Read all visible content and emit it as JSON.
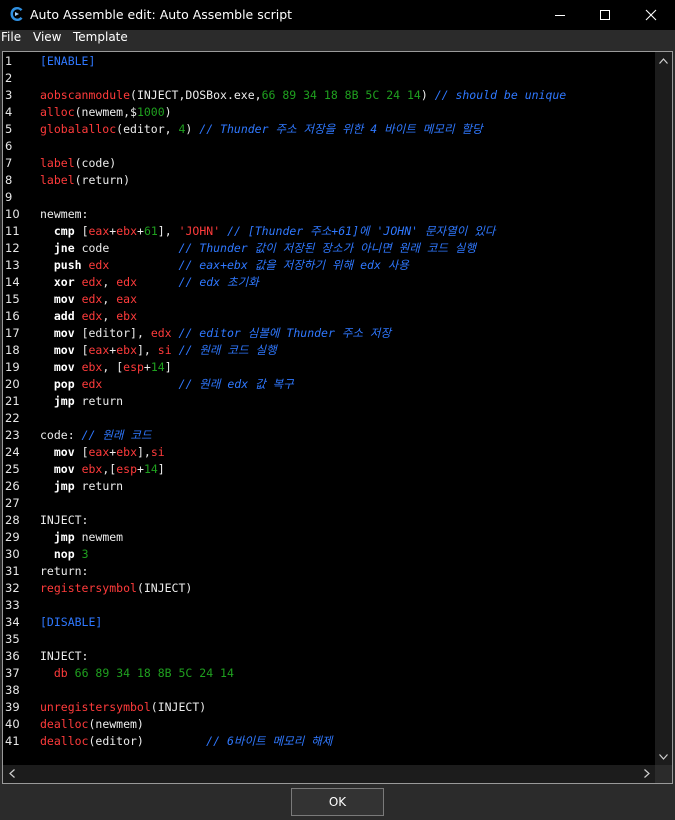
{
  "window": {
    "title": "Auto Assemble edit: Auto Assemble script",
    "controls": [
      "minimize-icon",
      "maximize-icon",
      "close-icon"
    ],
    "app_icon": "cheat-engine-icon"
  },
  "menu": [
    {
      "label": "File"
    },
    {
      "label": "View"
    },
    {
      "label": "Template"
    }
  ],
  "editor": {
    "lines": [
      {
        "n": "1",
        "tokens": [
          [
            "sec",
            "[ENABLE]"
          ]
        ]
      },
      {
        "n": "2",
        "tokens": []
      },
      {
        "n": "3",
        "tokens": [
          [
            "kw",
            "aobscanmodule"
          ],
          [
            "plain",
            "(INJECT,DOSBox.exe,"
          ],
          [
            "num",
            "66 89 34 18 8B 5C 24 14"
          ],
          [
            "plain",
            ") "
          ],
          [
            "cmt",
            "// should be unique"
          ]
        ]
      },
      {
        "n": "4",
        "tokens": [
          [
            "kw",
            "alloc"
          ],
          [
            "plain",
            "(newmem,"
          ],
          [
            "plain",
            "$"
          ],
          [
            "num",
            "1000"
          ],
          [
            "plain",
            ")"
          ]
        ]
      },
      {
        "n": "5",
        "tokens": [
          [
            "kw",
            "globalalloc"
          ],
          [
            "plain",
            "(editor, "
          ],
          [
            "num",
            "4"
          ],
          [
            "plain",
            ") "
          ],
          [
            "cmt",
            "// Thunder 주소 저장을 위한 4 바이트 메모리 할당"
          ]
        ]
      },
      {
        "n": "6",
        "tokens": []
      },
      {
        "n": "7",
        "tokens": [
          [
            "kw",
            "label"
          ],
          [
            "plain",
            "(code)"
          ]
        ]
      },
      {
        "n": "8",
        "tokens": [
          [
            "kw",
            "label"
          ],
          [
            "plain",
            "(return)"
          ]
        ]
      },
      {
        "n": "9",
        "tokens": []
      },
      {
        "n": "10",
        "tokens": [
          [
            "plain",
            "newmem:"
          ]
        ]
      },
      {
        "n": "11",
        "tokens": [
          [
            "plain",
            "  "
          ],
          [
            "ins",
            "cmp"
          ],
          [
            "plain",
            " ["
          ],
          [
            "reg",
            "eax"
          ],
          [
            "plain",
            "+"
          ],
          [
            "reg",
            "ebx"
          ],
          [
            "plain",
            "+"
          ],
          [
            "num",
            "61"
          ],
          [
            "plain",
            "], "
          ],
          [
            "str",
            "'JOHN'"
          ],
          [
            "plain",
            " "
          ],
          [
            "cmt",
            "// [Thunder 주소+61]에 'JOHN' 문자열이 있다"
          ]
        ]
      },
      {
        "n": "12",
        "tokens": [
          [
            "plain",
            "  "
          ],
          [
            "ins",
            "jne"
          ],
          [
            "plain",
            " code          "
          ],
          [
            "cmt",
            "// Thunder 값이 저장된 장소가 아니면 원래 코드 실행"
          ]
        ]
      },
      {
        "n": "13",
        "tokens": [
          [
            "plain",
            "  "
          ],
          [
            "ins",
            "push"
          ],
          [
            "plain",
            " "
          ],
          [
            "reg",
            "edx"
          ],
          [
            "plain",
            "          "
          ],
          [
            "cmt",
            "// eax+ebx 값을 저장하기 위해 edx 사용"
          ]
        ]
      },
      {
        "n": "14",
        "tokens": [
          [
            "plain",
            "  "
          ],
          [
            "ins",
            "xor"
          ],
          [
            "plain",
            " "
          ],
          [
            "reg",
            "edx"
          ],
          [
            "plain",
            ", "
          ],
          [
            "reg",
            "edx"
          ],
          [
            "plain",
            "      "
          ],
          [
            "cmt",
            "// edx 초기화"
          ]
        ]
      },
      {
        "n": "15",
        "tokens": [
          [
            "plain",
            "  "
          ],
          [
            "ins",
            "mov"
          ],
          [
            "plain",
            " "
          ],
          [
            "reg",
            "edx"
          ],
          [
            "plain",
            ", "
          ],
          [
            "reg",
            "eax"
          ]
        ]
      },
      {
        "n": "16",
        "tokens": [
          [
            "plain",
            "  "
          ],
          [
            "ins",
            "add"
          ],
          [
            "plain",
            " "
          ],
          [
            "reg",
            "edx"
          ],
          [
            "plain",
            ", "
          ],
          [
            "reg",
            "ebx"
          ]
        ]
      },
      {
        "n": "17",
        "tokens": [
          [
            "plain",
            "  "
          ],
          [
            "ins",
            "mov"
          ],
          [
            "plain",
            " [editor], "
          ],
          [
            "reg",
            "edx"
          ],
          [
            "plain",
            " "
          ],
          [
            "cmt",
            "// editor 심볼에 Thunder 주소 저장"
          ]
        ]
      },
      {
        "n": "18",
        "tokens": [
          [
            "plain",
            "  "
          ],
          [
            "ins",
            "mov"
          ],
          [
            "plain",
            " ["
          ],
          [
            "reg",
            "eax"
          ],
          [
            "plain",
            "+"
          ],
          [
            "reg",
            "ebx"
          ],
          [
            "plain",
            "], "
          ],
          [
            "reg",
            "si"
          ],
          [
            "plain",
            " "
          ],
          [
            "cmt",
            "// 원래 코드 실행"
          ]
        ]
      },
      {
        "n": "19",
        "tokens": [
          [
            "plain",
            "  "
          ],
          [
            "ins",
            "mov"
          ],
          [
            "plain",
            " "
          ],
          [
            "reg",
            "ebx"
          ],
          [
            "plain",
            ", ["
          ],
          [
            "reg",
            "esp"
          ],
          [
            "plain",
            "+"
          ],
          [
            "num",
            "14"
          ],
          [
            "plain",
            "]"
          ]
        ]
      },
      {
        "n": "20",
        "tokens": [
          [
            "plain",
            "  "
          ],
          [
            "ins",
            "pop"
          ],
          [
            "plain",
            " "
          ],
          [
            "reg",
            "edx"
          ],
          [
            "plain",
            "           "
          ],
          [
            "cmt",
            "// 원래 edx 값 복구"
          ]
        ]
      },
      {
        "n": "21",
        "tokens": [
          [
            "plain",
            "  "
          ],
          [
            "ins",
            "jmp"
          ],
          [
            "plain",
            " return"
          ]
        ]
      },
      {
        "n": "22",
        "tokens": []
      },
      {
        "n": "23",
        "tokens": [
          [
            "plain",
            "code: "
          ],
          [
            "cmt",
            "// 원래 코드"
          ]
        ]
      },
      {
        "n": "24",
        "tokens": [
          [
            "plain",
            "  "
          ],
          [
            "ins",
            "mov"
          ],
          [
            "plain",
            " ["
          ],
          [
            "reg",
            "eax"
          ],
          [
            "plain",
            "+"
          ],
          [
            "reg",
            "ebx"
          ],
          [
            "plain",
            "],"
          ],
          [
            "reg",
            "si"
          ]
        ]
      },
      {
        "n": "25",
        "tokens": [
          [
            "plain",
            "  "
          ],
          [
            "ins",
            "mov"
          ],
          [
            "plain",
            " "
          ],
          [
            "reg",
            "ebx"
          ],
          [
            "plain",
            ",["
          ],
          [
            "reg",
            "esp"
          ],
          [
            "plain",
            "+"
          ],
          [
            "num",
            "14"
          ],
          [
            "plain",
            "]"
          ]
        ]
      },
      {
        "n": "26",
        "tokens": [
          [
            "plain",
            "  "
          ],
          [
            "ins",
            "jmp"
          ],
          [
            "plain",
            " return"
          ]
        ]
      },
      {
        "n": "27",
        "tokens": []
      },
      {
        "n": "28",
        "tokens": [
          [
            "plain",
            "INJECT:"
          ]
        ]
      },
      {
        "n": "29",
        "tokens": [
          [
            "plain",
            "  "
          ],
          [
            "ins",
            "jmp"
          ],
          [
            "plain",
            " newmem"
          ]
        ]
      },
      {
        "n": "30",
        "tokens": [
          [
            "plain",
            "  "
          ],
          [
            "ins",
            "nop"
          ],
          [
            "plain",
            " "
          ],
          [
            "num",
            "3"
          ]
        ]
      },
      {
        "n": "31",
        "tokens": [
          [
            "plain",
            "return:"
          ]
        ]
      },
      {
        "n": "32",
        "tokens": [
          [
            "kw",
            "registersymbol"
          ],
          [
            "plain",
            "(INJECT)"
          ]
        ]
      },
      {
        "n": "33",
        "tokens": []
      },
      {
        "n": "34",
        "tokens": [
          [
            "sec",
            "[DISABLE]"
          ]
        ]
      },
      {
        "n": "35",
        "tokens": []
      },
      {
        "n": "36",
        "tokens": [
          [
            "plain",
            "INJECT:"
          ]
        ]
      },
      {
        "n": "37",
        "tokens": [
          [
            "plain",
            "  "
          ],
          [
            "kw",
            "db"
          ],
          [
            "plain",
            " "
          ],
          [
            "num",
            "66 89 34 18 8B 5C 24 14"
          ]
        ]
      },
      {
        "n": "38",
        "tokens": []
      },
      {
        "n": "39",
        "tokens": [
          [
            "kw",
            "unregistersymbol"
          ],
          [
            "plain",
            "(INJECT)"
          ]
        ]
      },
      {
        "n": "40",
        "tokens": [
          [
            "kw",
            "dealloc"
          ],
          [
            "plain",
            "(newmem)"
          ]
        ]
      },
      {
        "n": "41",
        "tokens": [
          [
            "kw",
            "dealloc"
          ],
          [
            "plain",
            "(editor)         "
          ],
          [
            "cmt",
            "// 6바이트 메모리 해제"
          ]
        ]
      }
    ]
  },
  "buttons": {
    "ok": "OK"
  },
  "colors": {
    "keyword": "#ff3b3b",
    "number": "#1fa01f",
    "comment": "#2f78ff",
    "section": "#2f78ff",
    "background": "#000000",
    "chrome": "#2b2b2b"
  }
}
